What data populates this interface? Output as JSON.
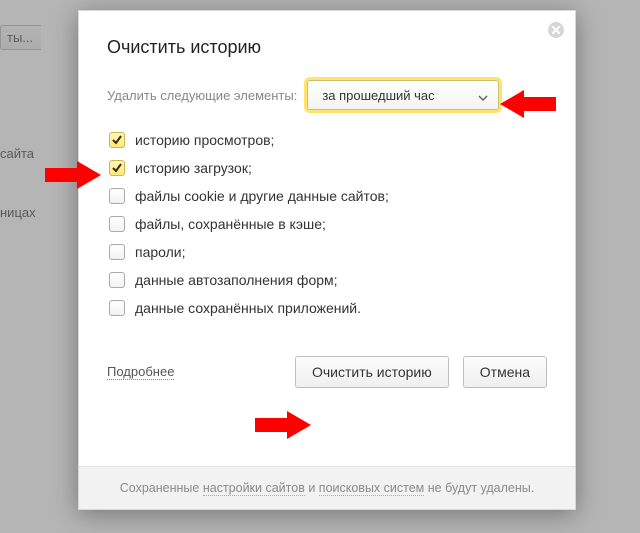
{
  "background": {
    "button_label": "ты...",
    "text1": "сайта",
    "text2": "ницах"
  },
  "dialog": {
    "title": "Очистить историю",
    "range_label": "Удалить следующие элементы:",
    "range_value": "за прошедший час",
    "options": [
      {
        "label": "историю просмотров;",
        "checked": true
      },
      {
        "label": "историю загрузок;",
        "checked": true
      },
      {
        "label": "файлы cookie и другие данные сайтов;",
        "checked": false
      },
      {
        "label": "файлы, сохранённые в кэше;",
        "checked": false
      },
      {
        "label": "пароли;",
        "checked": false
      },
      {
        "label": "данные автозаполнения форм;",
        "checked": false
      },
      {
        "label": "данные сохранённых приложений.",
        "checked": false
      }
    ],
    "more_link": "Подробнее",
    "clear_button": "Очистить историю",
    "cancel_button": "Отмена",
    "footer": {
      "t1": "Сохраненные ",
      "link1": "настройки сайтов",
      "t2": " и ",
      "link2": "поисковых систем",
      "t3": " не будут удалены."
    }
  }
}
